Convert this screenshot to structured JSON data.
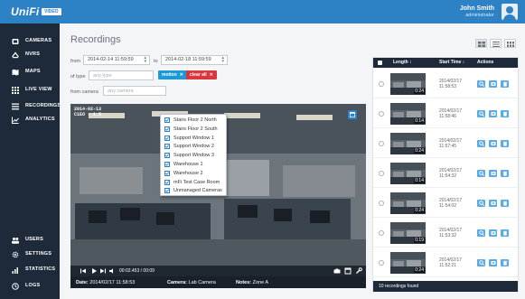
{
  "header": {
    "logo_text": "UniFi",
    "logo_badge": "VIDEO",
    "user_name": "John Smith",
    "user_role": "administrator",
    "brand_color": "#2d82c6"
  },
  "sidebar": {
    "items": [
      {
        "label": "CAMERAS",
        "icon": "camera-icon"
      },
      {
        "label": "NVRS",
        "icon": "nvr-icon"
      },
      {
        "label": "MAPS",
        "icon": "map-icon"
      },
      {
        "label": "LIVE VIEW",
        "icon": "grid-icon"
      },
      {
        "label": "RECORDINGS",
        "icon": "recordings-icon"
      },
      {
        "label": "ANALYTICS",
        "icon": "analytics-icon"
      }
    ],
    "bottom_items": [
      {
        "label": "USERS",
        "icon": "users-icon"
      },
      {
        "label": "SETTINGS",
        "icon": "gear-icon"
      },
      {
        "label": "STATISTICS",
        "icon": "statistics-icon"
      },
      {
        "label": "LOGS",
        "icon": "logs-icon"
      }
    ]
  },
  "main": {
    "title": "Recordings",
    "filters": {
      "from_label": "from",
      "from_value": "2014-02-14 11:59:59",
      "to_label": "to",
      "to_value": "2014-02-18 11:59:59",
      "type_label": "of type",
      "type_placeholder": "any type",
      "tag_motion": "motion",
      "tag_clear": "clear all",
      "camera_label": "from camera",
      "camera_placeholder": "any camera"
    },
    "camera_options": [
      "Stairs Floor 2 North",
      "Stairs Floor 2 South",
      "Support Window 1",
      "Support Window 2",
      "Support Window 3",
      "Warehouse 1",
      "Warehouse 2",
      "mFi Test Case Room",
      "Unmanaged Cameras"
    ],
    "video": {
      "timestamp_line1": "2014-02-13",
      "timestamp_line2": "C1EO - 1.5",
      "time_readout": "00:02.453 / 00:09",
      "date_label": "Date:",
      "date_value": "2014/02/17 11:58:53",
      "camera_label": "Camera:",
      "camera_value": "Lab Camera",
      "notes_label": "Notes:",
      "notes_value": "Zone A"
    }
  },
  "list": {
    "headers": {
      "length": "Length",
      "start": "Start Time",
      "actions": "Actions"
    },
    "rows": [
      {
        "duration": "0:24",
        "date": "2014/02/17",
        "time": "11:58:53"
      },
      {
        "duration": "0:14",
        "date": "2014/02/17",
        "time": "11:58:46"
      },
      {
        "duration": "0:24",
        "date": "2014/02/17",
        "time": "11:57:45"
      },
      {
        "duration": "0:14",
        "date": "2014/02/17",
        "time": "11:54:32"
      },
      {
        "duration": "0:24",
        "date": "2014/02/17",
        "time": "11:54:02"
      },
      {
        "duration": "0:19",
        "date": "2014/02/17",
        "time": "11:53:32"
      },
      {
        "duration": "0:24",
        "date": "2014/02/17",
        "time": "11:52:21"
      }
    ],
    "footer": "10 recordings found"
  },
  "colors": {
    "sidebar": "#1e2a3a",
    "tag_motion": "#1c9ad6",
    "tag_clear": "#d9363e",
    "action_button": "#5aaae6"
  }
}
